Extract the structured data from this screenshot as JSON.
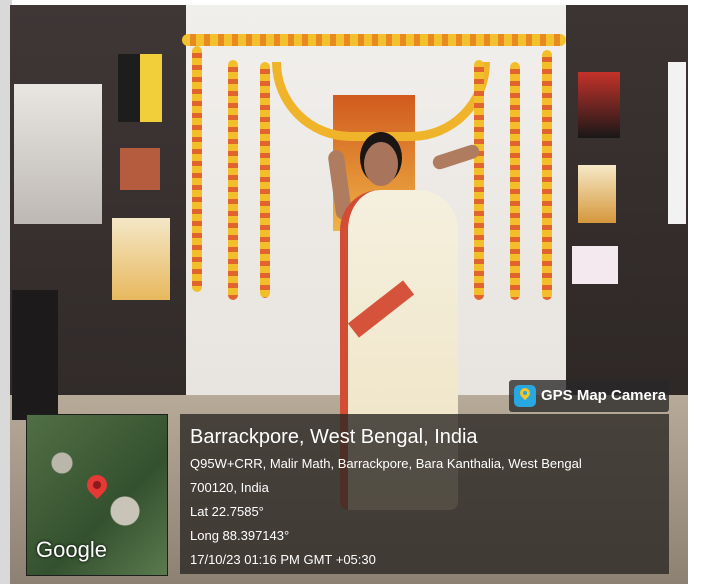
{
  "gps_badge": {
    "label": "GPS Map Camera",
    "icon": "map-camera-icon",
    "icon_color": "#29a7e0"
  },
  "map_thumbnail": {
    "logo_text": "Google",
    "marker_icon": "map-pin-icon",
    "marker_color": "#e53935"
  },
  "location": {
    "title": "Barrackpore, West Bengal, India",
    "address_line_1": "Q95W+CRR, Malir Math, Barrackpore, Bara Kanthalia, West Bengal",
    "address_line_2": "700120, India",
    "latitude": "Lat 22.7585°",
    "longitude": "Long 88.397143°",
    "timestamp": "17/10/23 01:16 PM GMT +05:30"
  }
}
